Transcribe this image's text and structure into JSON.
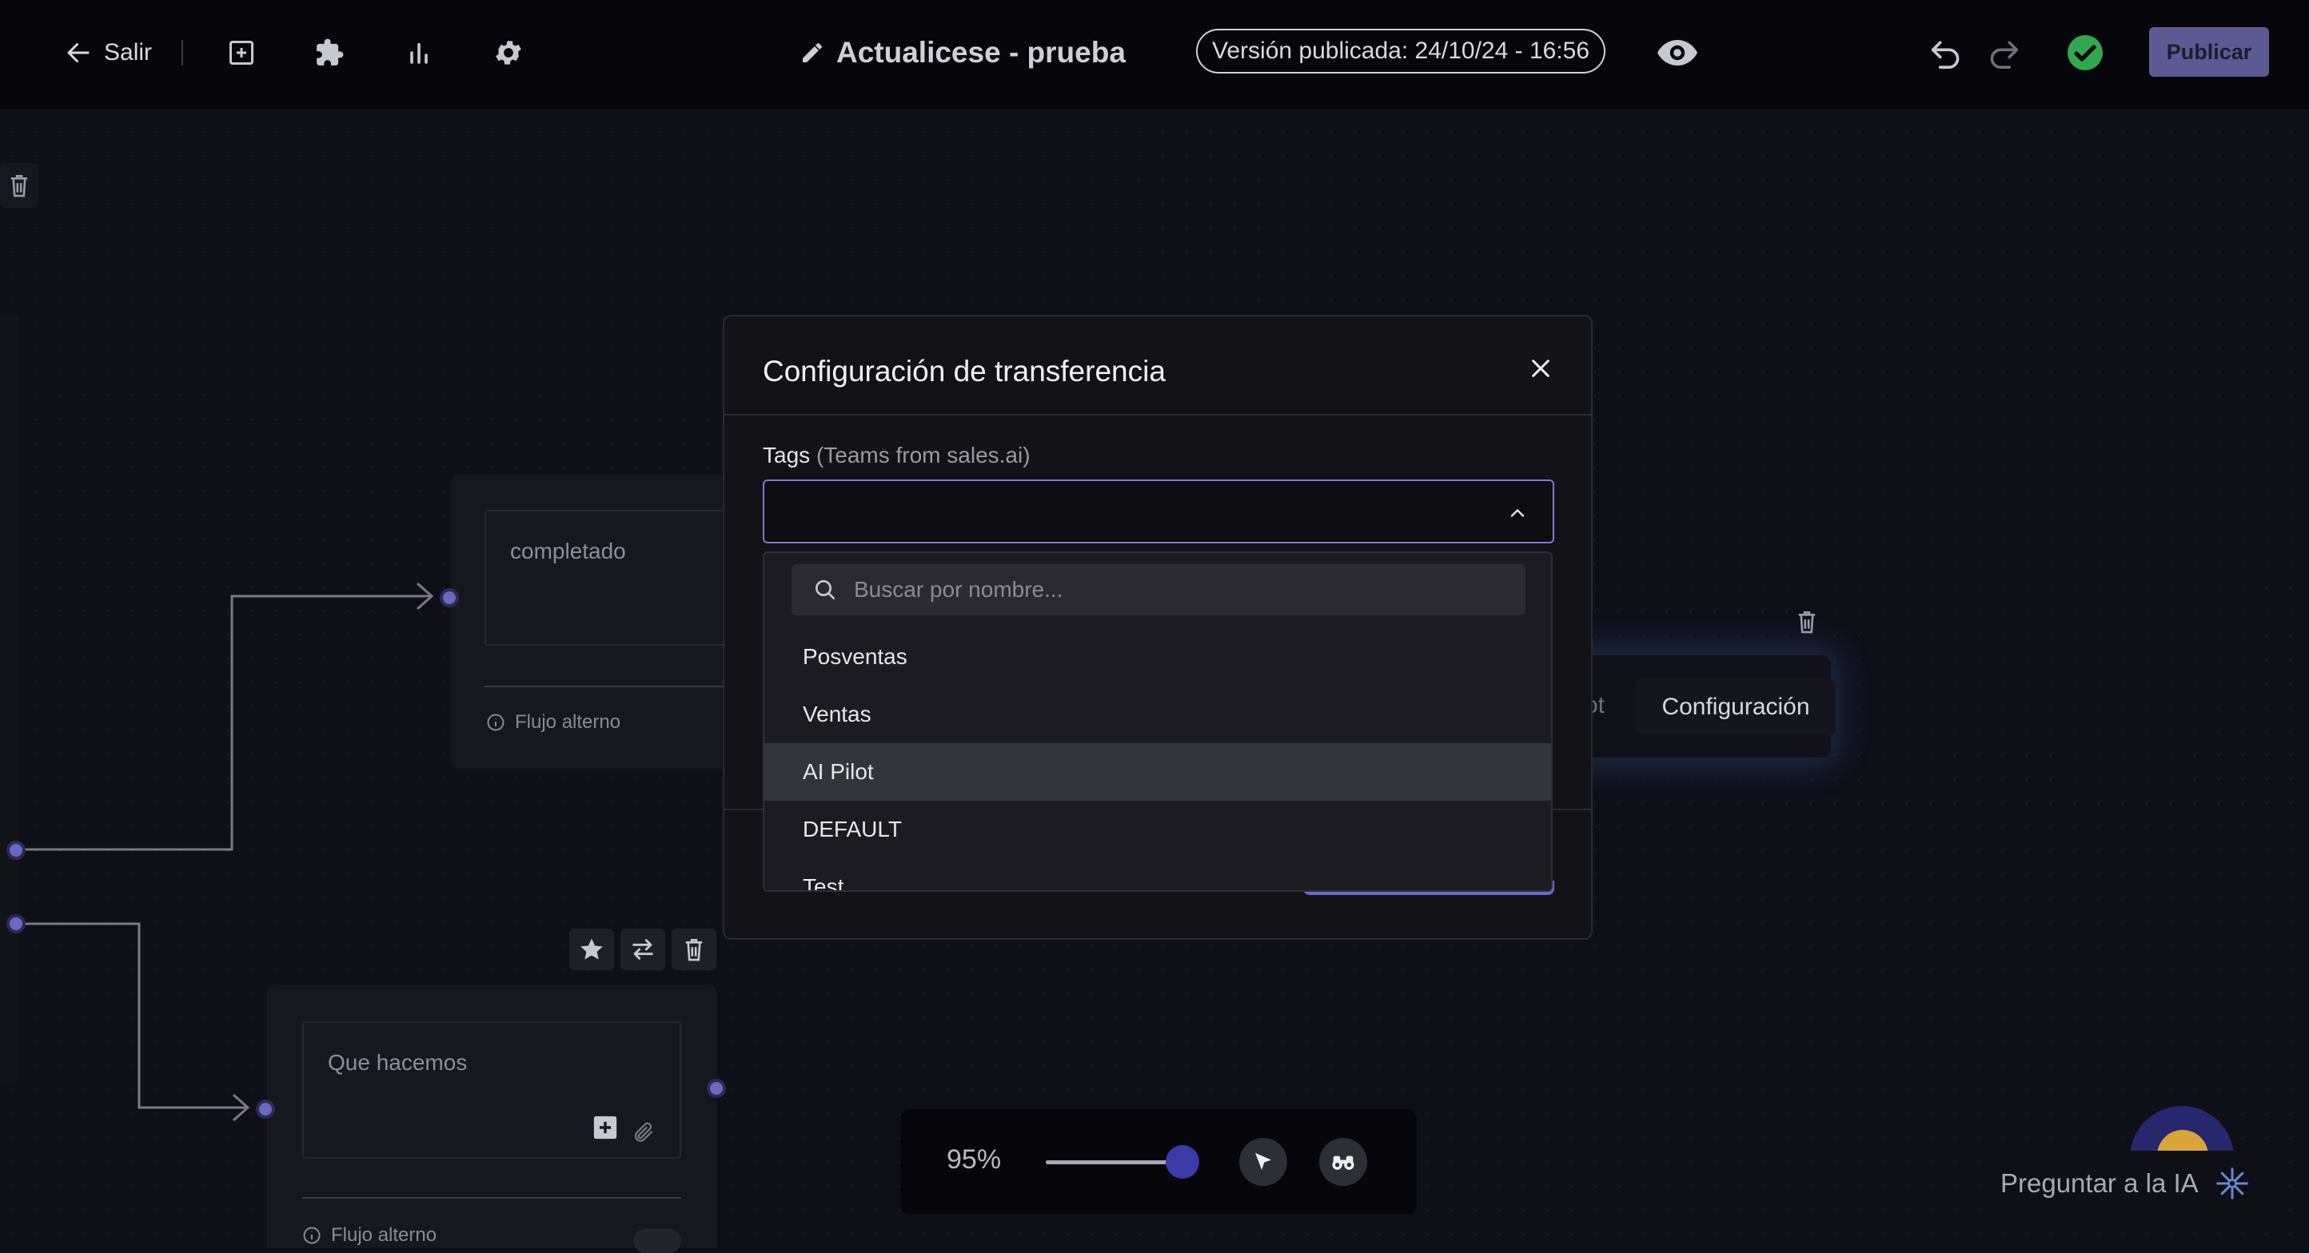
{
  "topbar": {
    "exit_label": "Salir",
    "icons": [
      "add-box-icon",
      "puzzle-icon",
      "bar-chart-icon",
      "gear-icon",
      "pencil-icon",
      "eye-icon",
      "undo-icon",
      "redo-icon",
      "check-circle-icon"
    ],
    "title": "Actualicese - prueba",
    "version_label": "Versión publicada: 24/10/24 - 16:56",
    "publish_label": "Publicar",
    "colors": {
      "publish_bg": "#5b5a93",
      "status_ok": "#2fa84f"
    }
  },
  "canvas": {
    "node_completado": {
      "text": "completado",
      "flow_label": "Flujo alterno"
    },
    "node_que_hacemos": {
      "text": "Que hacemos",
      "flow_label": "Flujo alterno"
    },
    "config_node": {
      "partial_label": "ot",
      "button_label": "Configuración"
    }
  },
  "modal": {
    "title": "Configuración de transferencia",
    "tags_label": "Tags",
    "tags_sublabel": "(Teams from sales.ai)",
    "select_value": "",
    "search_placeholder": "Buscar por nombre...",
    "options": [
      "Posventas",
      "Ventas",
      "AI Pilot",
      "DEFAULT",
      "Test"
    ],
    "highlighted_option": "AI Pilot",
    "accent_color": "#7b7bd0"
  },
  "zoom": {
    "label": "95%",
    "value_percent": 95
  },
  "ask_ai": {
    "label": "Preguntar a la IA"
  }
}
